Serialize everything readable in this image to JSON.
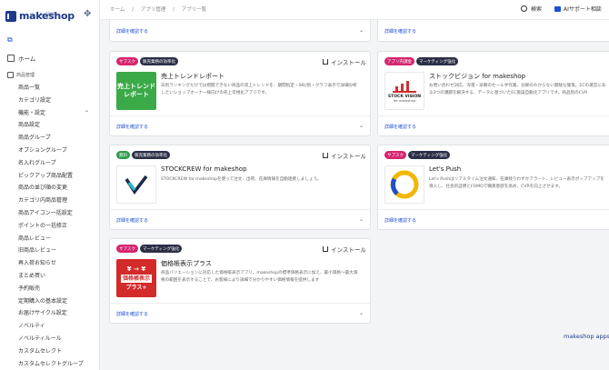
{
  "sidebar": {
    "logo": "makeshop",
    "logo_sub": "by GMO",
    "home": "ホーム",
    "section": "商品管理",
    "items": [
      {
        "label": "商品一覧"
      },
      {
        "label": "カテゴリ設定"
      },
      {
        "label": "機能・設定"
      },
      {
        "label": "商品設定"
      },
      {
        "label": "商品グループ"
      },
      {
        "label": "オプショングループ"
      },
      {
        "label": "名入れグループ"
      },
      {
        "label": "ピックアップ商品配置"
      },
      {
        "label": "商品の並び順の変更"
      },
      {
        "label": "カテゴリ内商品管理"
      },
      {
        "label": "商品アイコン一括設定"
      },
      {
        "label": "ポイントの一括修正"
      },
      {
        "label": "商品レビュー"
      },
      {
        "label": "旧商品レビュー"
      },
      {
        "label": "再入荷お知らせ"
      },
      {
        "label": "まとめ買い"
      },
      {
        "label": "予約販売"
      },
      {
        "label": "定期購入の基本設定"
      },
      {
        "label": "お届けサイクル設定"
      },
      {
        "label": "ノベルティ"
      },
      {
        "label": "ノベルティルール"
      },
      {
        "label": "カスタムセレクト"
      },
      {
        "label": "カスタムセレクトグループ"
      }
    ]
  },
  "topbar": {
    "crumbs": [
      "ホーム",
      "/",
      "アプリ管理",
      "/",
      "アプリ一覧"
    ],
    "search": "検索",
    "ai": "AIサポート相談"
  },
  "common": {
    "details": "詳細を確認する",
    "install": "インストール"
  },
  "cards": {
    "c1": {
      "badges": [
        "サブスク",
        "販売業務の効率化"
      ],
      "name": "売上トレンドレポート",
      "desc": "日別ランキングだけでは把握できない商品の売上トレンドを、期間指定・SKU別・グラフ表示で詳細分析したいショップオーナー様向けの売上可視化アプリです。",
      "thumb": "売上トレンドレポート"
    },
    "c2": {
      "badges": [
        "アプリ内課金",
        "マーケティング強化"
      ],
      "name": "ストックビジョン for makeshop",
      "desc": "お問い合わせ対応、深夜・早朝のセール手作業、効果のわからない無駄な施策。ECの運営にある3つの課題を解決する、データに基づいたEC施設自動化アプリです。商品別のCVR",
      "thumb_title": "STOCK VISION",
      "thumb_sub": "for makeshop"
    },
    "c3": {
      "badges": [
        "無料",
        "販売業務の効率化"
      ],
      "name": "STOCKCREW for makeshop",
      "desc": "STOCKCREW for makeshopを使って注文、出荷、在庫情報を自動連携しましょう。"
    },
    "c4": {
      "badges": [
        "サブスク",
        "マーケティング強化"
      ],
      "name": "Let's Push",
      "desc": "Let's Pushはリアルタイム注文通知、在庫残りわずかアラート、レビュー表示ポップアップを導入し、社会的証明とFOMOで購買意欲を高め、CVRを向上させます。"
    },
    "c5": {
      "badges": [
        "サブスク",
        "マーケティング強化"
      ],
      "name": "価格帳表示プラス",
      "desc": "商品バリエーションに対応した価格帳表示アプリ。makeshopの標準価格表示に加え、最小価格〜最大価格の範囲を表示することで、お客様により詳細で分かりやすい価格情報を提供します",
      "thumb_line1": "¥ → ¥",
      "thumb_line2": "価格帳表示",
      "thumb_line3": "プラス+"
    }
  },
  "footer": "makeshop apps",
  "colors": {
    "brand": "#1e3a8a",
    "link": "#1d4ed8",
    "badge_pink": "#d6246e",
    "badge_dark": "#2b2f45",
    "badge_green": "#2e9b4b"
  }
}
